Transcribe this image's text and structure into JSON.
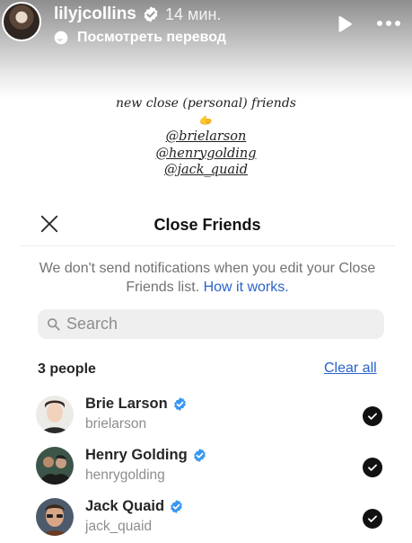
{
  "story": {
    "username": "lilyjcollins",
    "time": "14 мин.",
    "translate_label": "Посмотреть перевод",
    "icons": {
      "verified": "verified-badge-icon",
      "play": "play-icon",
      "more": "more-icon",
      "translate": "translate-icon"
    }
  },
  "caption": {
    "line1": "new close (personal) friends",
    "emoji": "🫱",
    "handles": [
      "@brielarson",
      "@henrygolding",
      "@jack_quaid"
    ]
  },
  "close_friends": {
    "title": "Close Friends",
    "notice_text": "We don't send notifications when you edit your Close Friends list.",
    "notice_link": "How it works.",
    "search_placeholder": "Search",
    "count_label": "3 people",
    "clear_all": "Clear all",
    "people": [
      {
        "name": "Brie Larson",
        "username": "brielarson",
        "verified": true,
        "selected": true
      },
      {
        "name": "Henry Golding",
        "username": "henrygolding",
        "verified": true,
        "selected": true
      },
      {
        "name": "Jack Quaid",
        "username": "jack_quaid",
        "verified": true,
        "selected": true
      }
    ]
  },
  "colors": {
    "link_blue": "#2b63c9",
    "verified_blue": "#3897f0",
    "check_black": "#111111"
  }
}
